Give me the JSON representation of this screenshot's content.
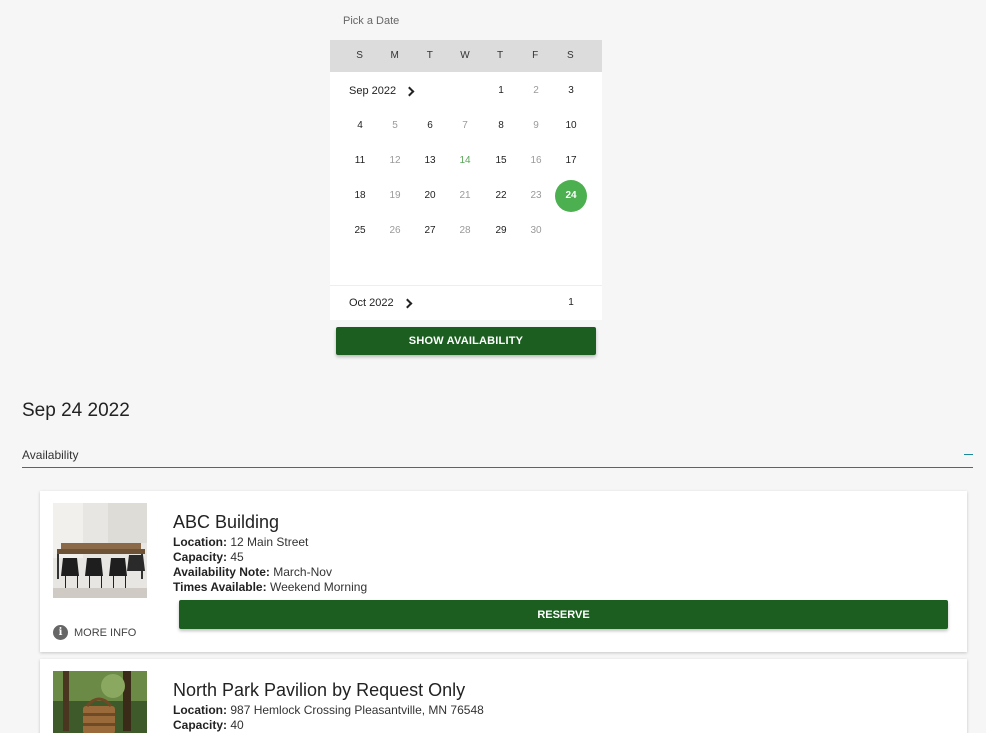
{
  "picker": {
    "label": "Pick a Date",
    "weekdays": [
      "S",
      "M",
      "T",
      "W",
      "T",
      "F",
      "S"
    ],
    "months": [
      {
        "label": "Sep 2022"
      },
      {
        "label": "Oct 2022"
      }
    ],
    "sep_days": [
      "1",
      "2",
      "3",
      "4",
      "5",
      "6",
      "7",
      "8",
      "9",
      "10",
      "11",
      "12",
      "13",
      "14",
      "15",
      "16",
      "17",
      "18",
      "19",
      "20",
      "21",
      "22",
      "23",
      "24",
      "25",
      "26",
      "27",
      "28",
      "29",
      "30"
    ],
    "oct_days": [
      "1"
    ],
    "selected_day": "24",
    "show_availability_label": "SHOW AVAILABILITY",
    "accent_color": "#4caf50",
    "button_color": "#1b5e20"
  },
  "results": {
    "date_heading": "Sep 24 2022",
    "section_label": "Availability",
    "collapse_icon": "minus-icon",
    "items": [
      {
        "title": "ABC Building",
        "fields": [
          {
            "label": "Location:",
            "value": "12 Main Street"
          },
          {
            "label": "Capacity:",
            "value": "45"
          },
          {
            "label": "Availability Note:",
            "value": "March-Nov"
          },
          {
            "label": "Times Available:",
            "value": "Weekend Morning"
          }
        ],
        "reserve_label": "RESERVE",
        "more_info_label": "MORE INFO"
      },
      {
        "title": "North Park Pavilion by Request Only",
        "fields": [
          {
            "label": "Location:",
            "value": "987 Hemlock Crossing Pleasantville, MN 76548"
          },
          {
            "label": "Capacity:",
            "value": "40"
          }
        ]
      }
    ]
  }
}
